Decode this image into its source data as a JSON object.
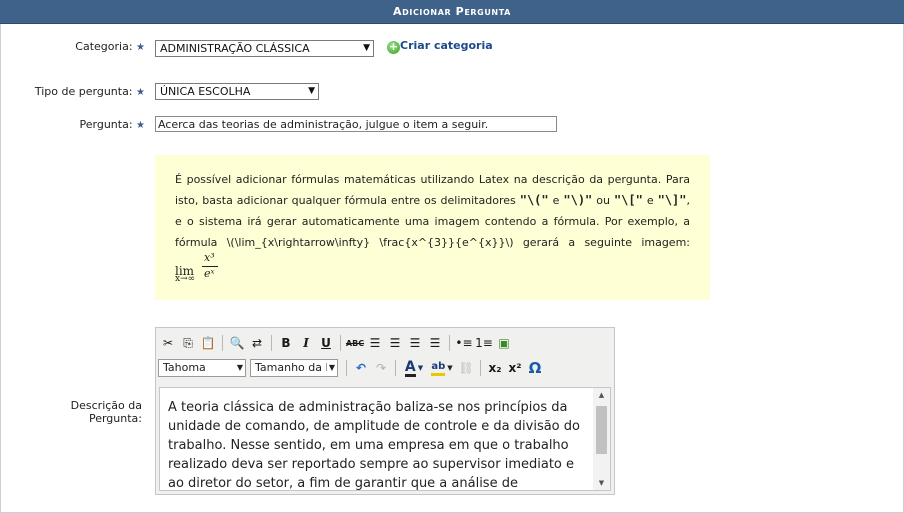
{
  "header": {
    "title": "Adicionar Pergunta"
  },
  "form": {
    "categoria_label": "Categoria:",
    "categoria_value": "ADMINISTRAÇÃO CLÁSSICA",
    "criar_categoria": "Criar categoria",
    "tipo_label": "Tipo de pergunta:",
    "tipo_value": "ÚNICA ESCOLHA",
    "pergunta_label": "Pergunta:",
    "pergunta_value": "Acerca das teorias de administração, julgue o item a seguir.",
    "descricao_label_1": "Descrição da",
    "descricao_label_2": "Pergunta:",
    "required_mark": "★"
  },
  "note": {
    "p1": "É possível adicionar fórmulas matemáticas utilizando Latex na descrição da pergunta. Para isto, basta adicionar qualquer fórmula entre os delimitadores ",
    "d1": "\"\\(\"",
    "e1": " e ",
    "d2": "\"\\)\"",
    "ou": " ou ",
    "d3": "\"\\[\"",
    "e2": " e ",
    "d4": "\"\\]\"",
    "p2": ", e o sistema irá gerar automaticamente uma imagem contendo a fórmula. Por exemplo, a fórmula \\(\\lim_{x\\rightarrow\\infty} \\frac{x^{3}}{e^{x}}\\) gerará a seguinte imagem: ",
    "formula_lim": "lim",
    "formula_sub": "x→∞",
    "formula_num": "x³",
    "formula_den": "eˣ"
  },
  "editor": {
    "font_family": "Tahoma",
    "font_size": "Tamanho da F",
    "bold": "B",
    "italic": "I",
    "underline": "U",
    "strike": "ABC",
    "subscript": "x₂",
    "superscript": "x²",
    "omega": "Ω",
    "text_color": "A",
    "highlight": "ab",
    "content": "A teoria clássica de administração baliza-se nos princípios da unidade de comando, de amplitude de controle e da divisão do trabalho. Nesse sentido, em uma empresa em que o trabalho realizado deva ser reportado sempre ao supervisor imediato e ao diretor do setor, a fim de garantir que a análise de desempenho"
  },
  "colors": {
    "header_bg": "#3f628a",
    "note_bg": "#ffffd5",
    "link": "#1c4a8a",
    "star": "#3a5f8f"
  }
}
